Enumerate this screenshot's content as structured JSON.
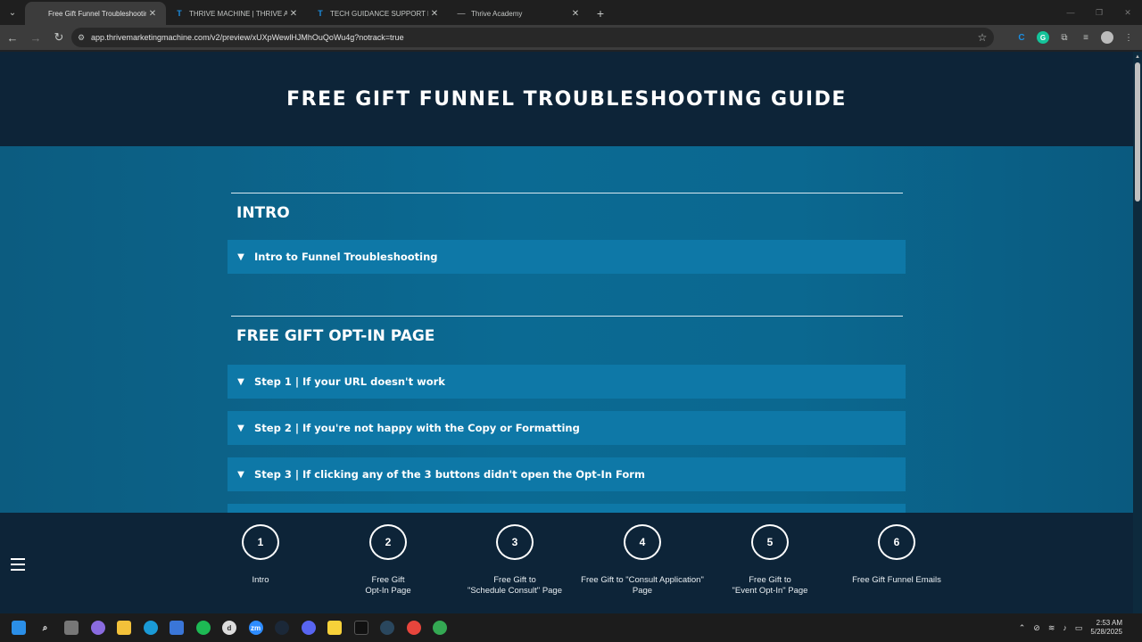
{
  "browser": {
    "tabs": [
      {
        "title": "Free Gift Funnel Troubleshooting",
        "icon": "page",
        "active": true
      },
      {
        "title": "THRIVE MACHINE | THRIVE ACADEMY",
        "icon": "thrive-logo",
        "active": false
      },
      {
        "title": "TECH GUIDANCE SUPPORT BOARD",
        "icon": "thrive-logo",
        "active": false
      },
      {
        "title": "Thrive Academy",
        "icon": "dash",
        "active": false
      }
    ],
    "url": "app.thrivemarketingmachine.com/v2/preview/xUXpWewlHJMhOuQoWu4g?notrack=true"
  },
  "page": {
    "title": "FREE GIFT FUNNEL TROUBLESHOOTING GUIDE",
    "sections": [
      {
        "heading": "INTRO",
        "items": [
          "Intro to Funnel Troubleshooting"
        ]
      },
      {
        "heading": "FREE GIFT OPT-IN PAGE",
        "items": [
          "Step 1 | If your URL doesn't work",
          "Step 2 | If you're not happy with the Copy or Formatting",
          "Step 3 | If clicking any of the 3 buttons didn't open the Opt-In Form"
        ]
      }
    ],
    "steps": [
      {
        "num": "1",
        "label": "Intro"
      },
      {
        "num": "2",
        "label": "Free Gift\nOpt-In Page"
      },
      {
        "num": "3",
        "label": "Free Gift to\n\"Schedule Consult\" Page"
      },
      {
        "num": "4",
        "label": "Free Gift to \"Consult Application\"\nPage"
      },
      {
        "num": "5",
        "label": "Free Gift to\n\"Event Opt-In\" Page"
      },
      {
        "num": "6",
        "label": "Free Gift Funnel Emails"
      }
    ]
  },
  "taskbar": {
    "time": "2:53 AM",
    "date": "5/28/2025"
  },
  "colors": {
    "hero_bg": "#0d2438",
    "content_bg": "#0b6a93",
    "accordion_bg": "#0e78a7"
  }
}
